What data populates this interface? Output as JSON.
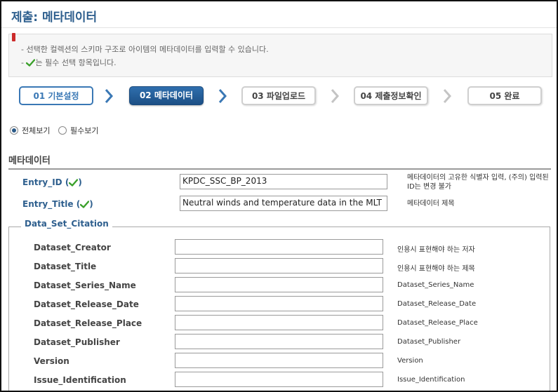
{
  "page": {
    "title": "제출: 메타데이터"
  },
  "notice": {
    "line1": "- 선택한 컬렉션의 스키마 구조로 아이템의 메타데이터를 입력할 수 있습니다.",
    "line2_prefix": "-",
    "line2_suffix": "는 필수 선택 항목입니다."
  },
  "steps": [
    {
      "label": "01 기본설정",
      "state": "done"
    },
    {
      "label": "02 메타데이터",
      "state": "active"
    },
    {
      "label": "03 파일업로드",
      "state": "todo"
    },
    {
      "label": "04 제출정보확인",
      "state": "todo"
    },
    {
      "label": "05 완료",
      "state": "todo"
    }
  ],
  "view_options": {
    "all": "전체보기",
    "required": "필수보기",
    "selected": "all"
  },
  "section": {
    "title": "메타데이터"
  },
  "fields": [
    {
      "label": "Entry_ID",
      "value": "KPDC_SSC_BP_2013",
      "desc": "메타데이터의 고유한 식별자 입력, (주의) 입력된 ID는 변경 불가",
      "required": true
    },
    {
      "label": "Entry_Title",
      "value": "Neutral winds and temperature data in the MLT",
      "desc": "메타데이터 제목",
      "required": true
    }
  ],
  "citation": {
    "legend": "Data_Set_Citation",
    "fields": [
      {
        "label": "Dataset_Creator",
        "value": "",
        "desc": "인용시 표현해야 하는 저자"
      },
      {
        "label": "Dataset_Title",
        "value": "",
        "desc": "인용시 표현해야 하는 제목"
      },
      {
        "label": "Dataset_Series_Name",
        "value": "",
        "desc": "Dataset_Series_Name"
      },
      {
        "label": "Dataset_Release_Date",
        "value": "",
        "desc": "Dataset_Release_Date"
      },
      {
        "label": "Dataset_Release_Place",
        "value": "",
        "desc": "Dataset_Release_Place"
      },
      {
        "label": "Dataset_Publisher",
        "value": "",
        "desc": "Dataset_Publisher"
      },
      {
        "label": "Version",
        "value": "",
        "desc": "Version"
      },
      {
        "label": "Issue_Identification",
        "value": "",
        "desc": "Issue_Identification"
      }
    ]
  },
  "colors": {
    "accent": "#2e5f8e",
    "check": "#3aa02a",
    "active_step": "#245e99"
  },
  "icons": {
    "check": "check-icon",
    "step_separator": "chevron-right-icon",
    "notice_marker": "flag-icon"
  }
}
